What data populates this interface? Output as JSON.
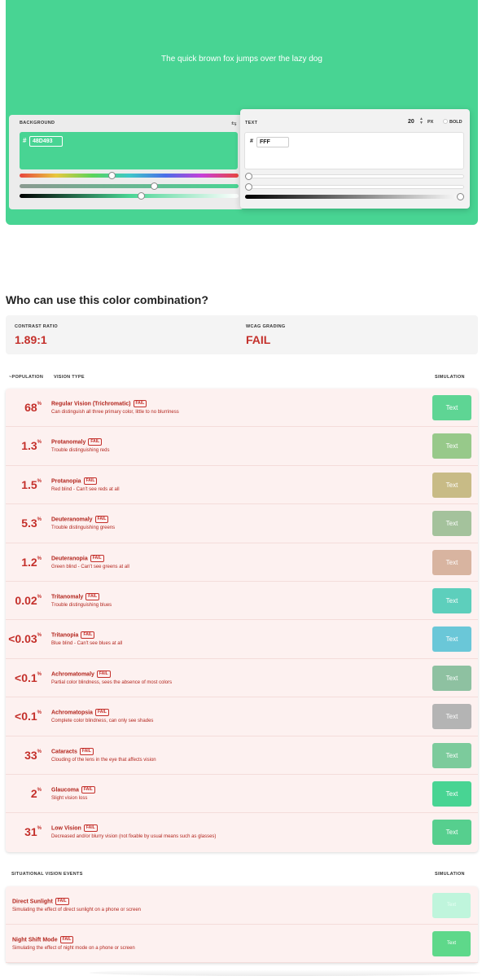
{
  "preview": {
    "sample_text": "The quick brown fox jumps over the lazy dog",
    "background_color": "#48D493",
    "text_color": "#FFFFFF"
  },
  "background_panel": {
    "label": "BACKGROUND",
    "hash": "#",
    "hex_value": "48D493",
    "swap_icon": "swap-icon"
  },
  "text_panel": {
    "label": "TEXT",
    "hash": "#",
    "hex_value": "FFF",
    "font_size": "20",
    "px_label": "PX",
    "bold_label": "BOLD"
  },
  "heading": "Who can use this color combination?",
  "summary": {
    "contrast_label": "CONTRAST RATIO",
    "contrast_value": "1.89:1",
    "wcag_label": "WCAG GRADING",
    "wcag_value": "FAIL"
  },
  "table_headers": {
    "population": "~POPULATION",
    "vision_type": "VISION TYPE",
    "simulation": "SIMULATION"
  },
  "badge_text": "FAIL",
  "pct_unit": "%",
  "vision_rows": [
    {
      "pct": "68",
      "name": "Regular Vision (Trichromatic)",
      "desc": "Can distinguish all three primary color, little to no blurriness",
      "sim_label": "Text",
      "sim_color": "#5ed594"
    },
    {
      "pct": "1.3",
      "name": "Protanomaly",
      "desc": "Trouble distinguishing reds",
      "sim_label": "Text",
      "sim_color": "#97c98a"
    },
    {
      "pct": "1.5",
      "name": "Protanopia",
      "desc": "Red blind - Can't see reds at all",
      "sim_label": "Text",
      "sim_color": "#c8bb86"
    },
    {
      "pct": "5.3",
      "name": "Deuteranomaly",
      "desc": "Trouble distinguishing greens",
      "sim_label": "Text",
      "sim_color": "#a4c29c"
    },
    {
      "pct": "1.2",
      "name": "Deuteranopia",
      "desc": "Green blind - Can't see greens at all",
      "sim_label": "Text",
      "sim_color": "#d8b4a0"
    },
    {
      "pct": "0.02",
      "name": "Tritanomaly",
      "desc": "Trouble distinguishing blues",
      "sim_label": "Text",
      "sim_color": "#5dcfbc"
    },
    {
      "pct": "<0.03",
      "name": "Tritanopia",
      "desc": "Blue blind - Can't see blues at all",
      "sim_label": "Text",
      "sim_color": "#6ac7d8"
    },
    {
      "pct": "<0.1",
      "name": "Achromatomaly",
      "desc": "Partial color blindness, sees the absence of most colors",
      "sim_label": "Text",
      "sim_color": "#8ec1a1"
    },
    {
      "pct": "<0.1",
      "name": "Achromatopsia",
      "desc": "Complete color blindness, can only see shades",
      "sim_label": "Text",
      "sim_color": "#b4b4b4"
    },
    {
      "pct": "33",
      "name": "Cataracts",
      "desc": "Clouding of the lens in the eye that affects vision",
      "sim_label": "Text",
      "sim_color": "#7ccb9c"
    },
    {
      "pct": "2",
      "name": "Glaucoma",
      "desc": "Slight vision loss",
      "sim_label": "Text",
      "sim_color": "#48d493"
    },
    {
      "pct": "31",
      "name": "Low Vision",
      "desc": "Decreased and/or blurry vision (not fixable by usual means such as glasses)",
      "sim_label": "Text",
      "sim_color": "#56cf8e"
    }
  ],
  "situational_headers": {
    "title": "SITUATIONAL VISION EVENTS",
    "simulation": "SIMULATION"
  },
  "situational_rows": [
    {
      "name": "Direct Sunlight",
      "desc": "Simulating the effect of direct sunlight on a phone or screen",
      "sim_label": "Text",
      "sim_color": "#bff5dc"
    },
    {
      "name": "Night Shift Mode",
      "desc": "Simulating the effect of night mode on a phone or screen",
      "sim_label": "Text",
      "sim_color": "#5ed88a"
    }
  ]
}
